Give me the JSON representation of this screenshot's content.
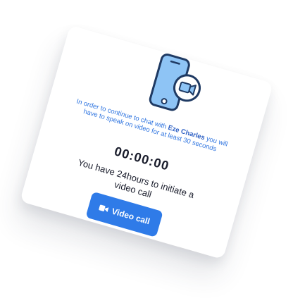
{
  "card": {
    "info_prefix": "In order to continue to chat with ",
    "contact_name": "Eze Charles",
    "info_suffix": " you will have to speak on video for at least 30 seconds",
    "timer": "00:00:00",
    "notice": "You have 24hours to initiate a video call",
    "button_label": "Video call"
  },
  "colors": {
    "accent": "#2f7be8",
    "illustration_fill": "#8ec4f5",
    "illustration_stroke": "#1f3a63"
  },
  "icons": {
    "illustration": "phone-video-icon",
    "button_icon": "camera-icon"
  }
}
